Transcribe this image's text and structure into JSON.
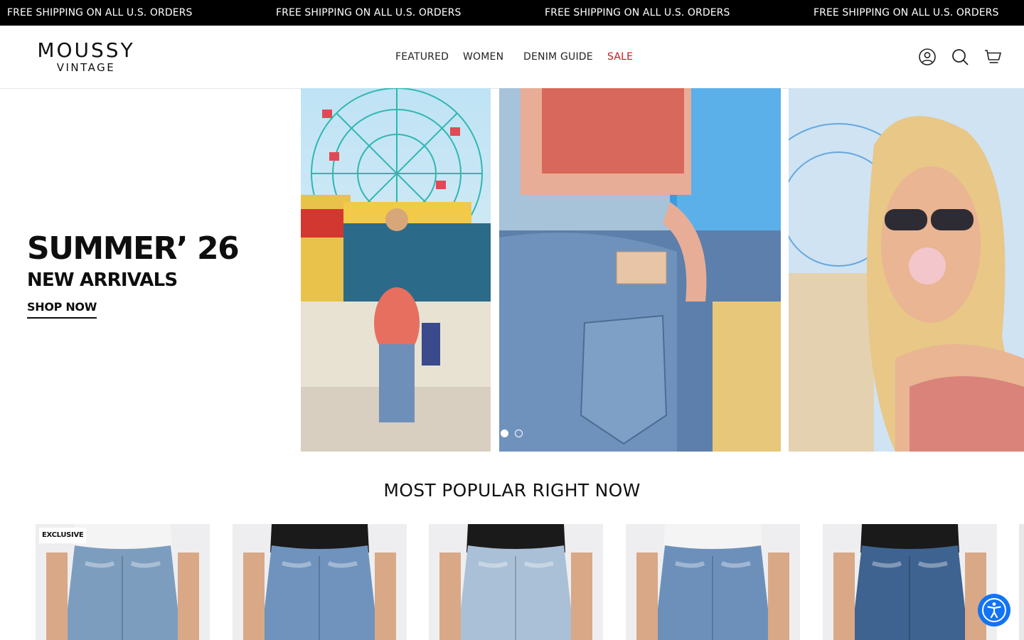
{
  "announcement": {
    "messages": [
      "FREE SHIPPING ON ALL U.S. ORDERS",
      "FREE SHIPPING ON ALL U.S. ORDERS",
      "FREE SHIPPING ON ALL U.S. ORDERS",
      "FREE SHIPPING ON ALL U.S. ORDERS"
    ]
  },
  "header": {
    "logo_top": "MOUSSY",
    "logo_bottom": "VINTAGE",
    "nav": [
      {
        "label": "FEATURED"
      },
      {
        "label": "WOMEN"
      },
      {
        "label": "DENIM GUIDE"
      },
      {
        "label": "SALE"
      }
    ],
    "icons": [
      "account-icon",
      "search-icon",
      "cart-icon"
    ]
  },
  "hero": {
    "title": "SUMMER’ 26",
    "subtitle": "NEW ARRIVALS",
    "cta": "SHOP NOW",
    "slide_dots": [
      {
        "active": true
      },
      {
        "active": false
      }
    ]
  },
  "popular": {
    "title": "MOST POPULAR RIGHT NOW",
    "products": [
      {
        "badge": "EXCLUSIVE",
        "top_color": "#f4f4f4",
        "denim_color": "#7d9dbf"
      },
      {
        "badge": "",
        "top_color": "#1a1a1a",
        "denim_color": "#6f93bd"
      },
      {
        "badge": "",
        "top_color": "#1a1a1a",
        "denim_color": "#a9c0d6"
      },
      {
        "badge": "",
        "top_color": "#f4f4f4",
        "denim_color": "#6d90bb"
      },
      {
        "badge": "",
        "top_color": "#1a1a1a",
        "denim_color": "#3e6390"
      }
    ]
  },
  "colors": {
    "announcement_bg": "#000000",
    "sale_red": "#d0121b",
    "accessibility_blue": "#1273f5"
  }
}
